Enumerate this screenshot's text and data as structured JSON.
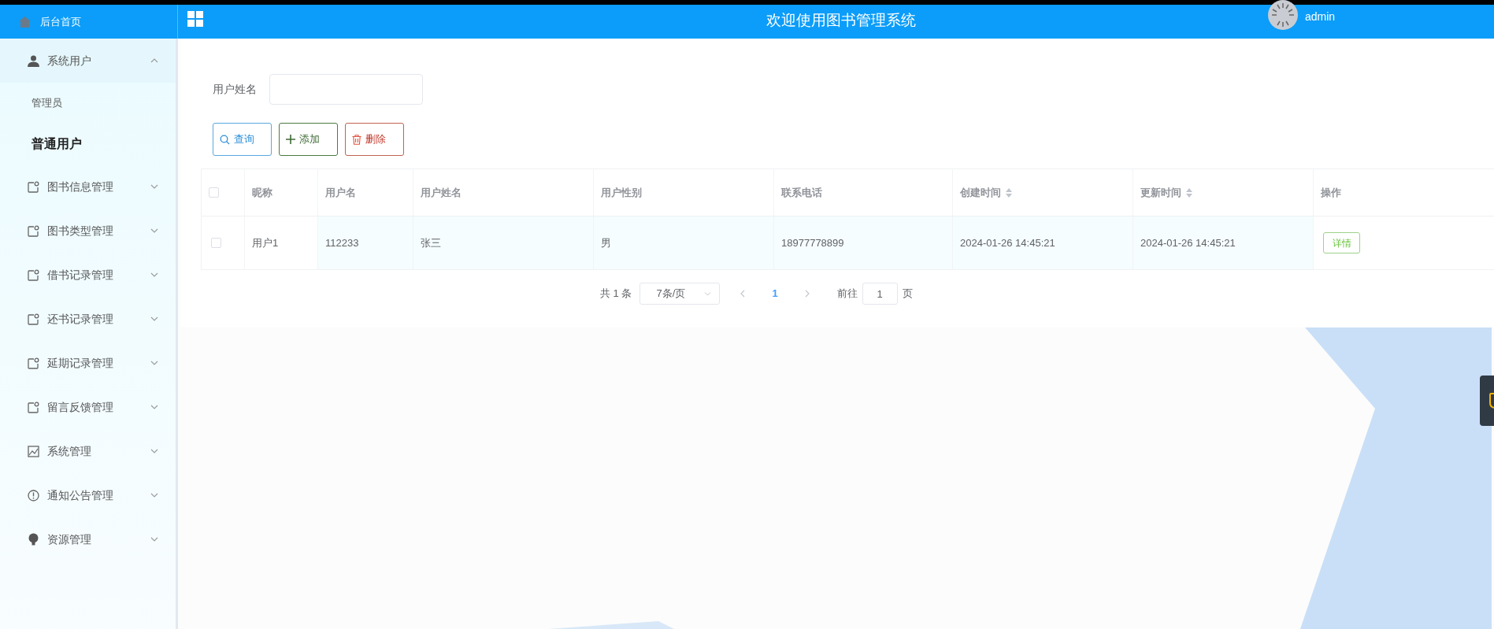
{
  "header": {
    "home": "后台首页",
    "title": "欢迎使用图书管理系统",
    "user": "admin"
  },
  "sidebar": {
    "items": [
      {
        "label": "系统用户",
        "kind": "user",
        "expanded": true,
        "children": [
          {
            "label": "管理员",
            "selected": false
          },
          {
            "label": "普通用户",
            "selected": true
          }
        ]
      },
      {
        "label": "图书信息管理",
        "kind": "tag",
        "expanded": false
      },
      {
        "label": "图书类型管理",
        "kind": "tag",
        "expanded": false
      },
      {
        "label": "借书记录管理",
        "kind": "tag",
        "expanded": false
      },
      {
        "label": "还书记录管理",
        "kind": "tag",
        "expanded": false
      },
      {
        "label": "延期记录管理",
        "kind": "tag",
        "expanded": false
      },
      {
        "label": "留言反馈管理",
        "kind": "tag",
        "expanded": false
      },
      {
        "label": "系统管理",
        "kind": "image",
        "expanded": false
      },
      {
        "label": "通知公告管理",
        "kind": "info",
        "expanded": false
      },
      {
        "label": "资源管理",
        "kind": "bulb",
        "expanded": false
      }
    ]
  },
  "search": {
    "label": "用户姓名"
  },
  "buttons": [
    {
      "label": "查询",
      "kind": "search"
    },
    {
      "label": "添加",
      "kind": "add"
    },
    {
      "label": "删除",
      "kind": "delete"
    }
  ],
  "table": {
    "all_checked": false,
    "columns": [
      {
        "label": "昵称",
        "sortable": false
      },
      {
        "label": "用户名",
        "sortable": false
      },
      {
        "label": "用户姓名",
        "sortable": false
      },
      {
        "label": "用户性别",
        "sortable": false
      },
      {
        "label": "联系电话",
        "sortable": false
      },
      {
        "label": "创建时间",
        "sortable": true
      },
      {
        "label": "更新时间",
        "sortable": true
      },
      {
        "label": "操作",
        "sortable": false
      }
    ],
    "rows": [
      {
        "checked": false,
        "cells": [
          "用户1",
          "112233",
          "张三",
          "男",
          "18977778899",
          "2024-01-26 14:45:21",
          "2024-01-26 14:45:21"
        ],
        "action": "详情"
      }
    ]
  },
  "pagination": {
    "total": "共 1 条",
    "page_size": "7条/页",
    "pages": [
      {
        "label": "1",
        "selected": true
      }
    ],
    "goto_label": "前往",
    "goto_value": "1",
    "goto_suffix": "页"
  }
}
